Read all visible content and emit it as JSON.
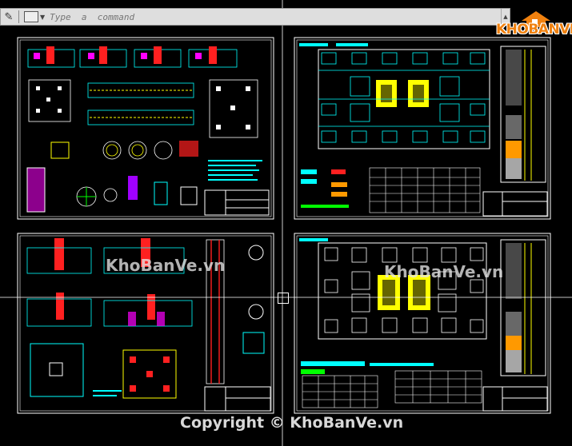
{
  "command_line": {
    "placeholder": "Type  a  command",
    "value": ""
  },
  "logo": {
    "text": "KHOBANVE",
    "brand_color": "#f0810f"
  },
  "watermarks": [
    "KhoBanVe.vn",
    "KhoBanVe.vn"
  ],
  "footer": {
    "copyright": "Copyright © KhoBanVe.vn"
  },
  "colors": {
    "background": "#000000",
    "sheet_border": "#ffffff",
    "cad_cyan": "#00ffff",
    "cad_green": "#00ff00",
    "cad_red": "#ff2020",
    "cad_yellow": "#ffff00",
    "cad_magenta": "#ff00ff"
  },
  "icons": [
    "wrench-icon",
    "terminal-icon",
    "chevron-down-icon",
    "cursor-crosshair-icon"
  ]
}
